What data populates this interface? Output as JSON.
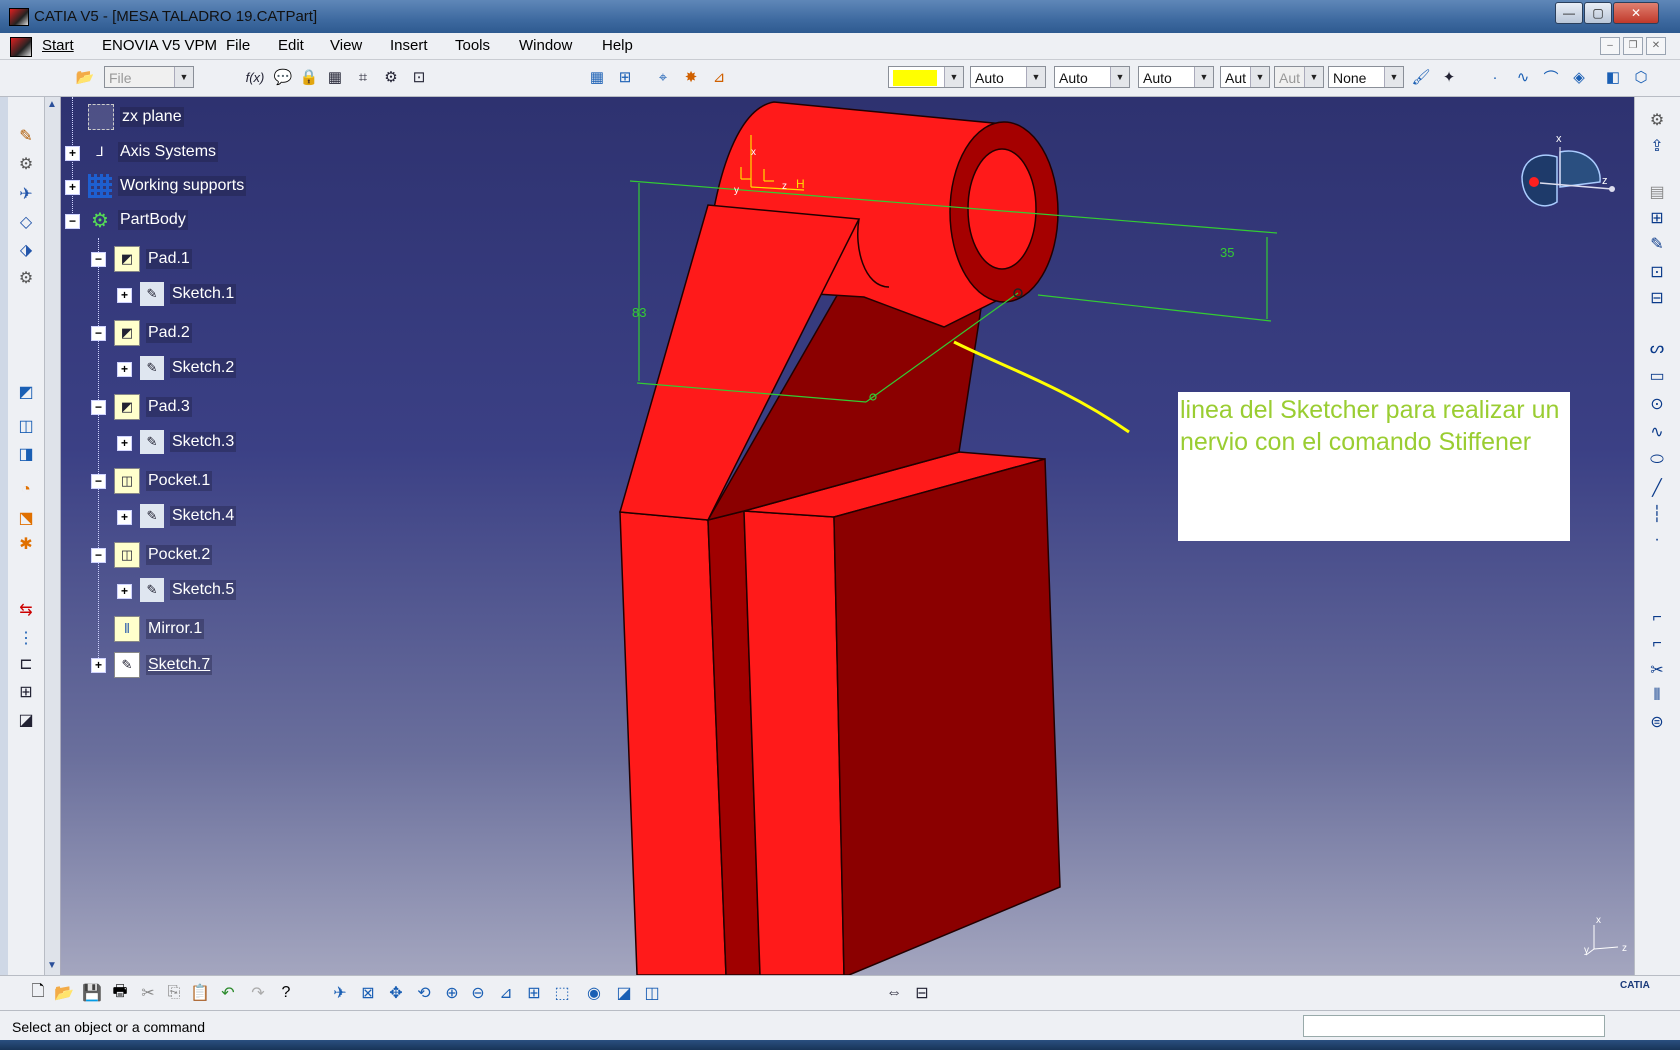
{
  "window": {
    "title": "CATIA V5 - [MESA TALADRO 19.CATPart]",
    "min_label": "—",
    "max_label": "▢",
    "close_label": "✕"
  },
  "menu": {
    "items": [
      "Start",
      "ENOVIA V5 VPM",
      "File",
      "Edit",
      "View",
      "Insert",
      "Tools",
      "Window",
      "Help"
    ]
  },
  "toolbar": {
    "file_select": "File",
    "color_select": "",
    "linetype_select": "Auto",
    "thickness_select": "Auto",
    "linestyle_select": "Auto",
    "layer_select": "Aut",
    "layer2_select": "Aut",
    "render_select": "None"
  },
  "tree": {
    "nodes": [
      {
        "label": "zx plane"
      },
      {
        "label": "Axis Systems"
      },
      {
        "label": "Working supports"
      },
      {
        "label": "PartBody"
      },
      {
        "label": "Pad.1"
      },
      {
        "label": "Sketch.1"
      },
      {
        "label": "Pad.2"
      },
      {
        "label": "Sketch.2"
      },
      {
        "label": "Pad.3"
      },
      {
        "label": "Sketch.3"
      },
      {
        "label": "Pocket.1"
      },
      {
        "label": "Sketch.4"
      },
      {
        "label": "Pocket.2"
      },
      {
        "label": "Sketch.5"
      },
      {
        "label": "Mirror.1"
      },
      {
        "label": "Sketch.7"
      }
    ]
  },
  "model": {
    "dim_vertical": "83",
    "dim_right": "35",
    "axis_h": "H",
    "axis_x": "x",
    "axis_y": "y",
    "axis_z": "z"
  },
  "annotation": {
    "text": "linea del Sketcher para realizar un nervio con el comando Stiffener"
  },
  "compass": {
    "x": "x",
    "z": "z"
  },
  "corner_axis": {
    "x": "x",
    "y": "y",
    "z": "z"
  },
  "brand": {
    "logo": "CATIA"
  },
  "status": {
    "text": "Select an object or a command"
  },
  "colors": {
    "part_red": "#ff1a1a",
    "sketch_green": "#33cc33",
    "note_text": "#9acd32"
  }
}
